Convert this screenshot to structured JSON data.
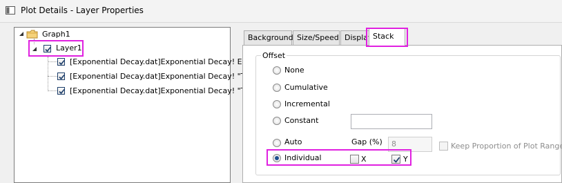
{
  "window": {
    "title": "Plot Details - Layer Properties"
  },
  "tree": {
    "root": "Graph1",
    "layer": "Layer1",
    "plots": [
      "[Exponential Decay.dat]Exponential Decay! E(X",
      "[Exponential Decay.dat]Exponential Decay! \"Tir",
      "[Exponential Decay.dat]Exponential Decay! \"Tir"
    ]
  },
  "tabs": [
    "Background",
    "Size/Speed",
    "Display",
    "Stack"
  ],
  "active_tab": "Stack",
  "stack": {
    "group_label": "Offset",
    "options": [
      "None",
      "Cumulative",
      "Incremental",
      "Constant",
      "Auto",
      "Individual"
    ],
    "selected": "Individual",
    "constant_value": "",
    "gap_label": "Gap (%)",
    "gap_value": "8",
    "keep_proportion_label": "Keep Proportion of Plot Range",
    "x_label": "X",
    "x_checked": false,
    "y_label": "Y",
    "y_checked": true
  },
  "highlight_color": "#e020e0"
}
